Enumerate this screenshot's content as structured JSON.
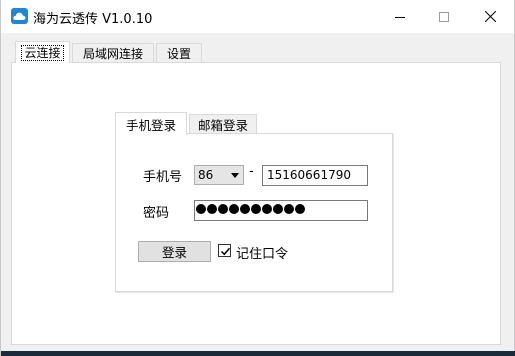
{
  "window": {
    "title": "海为云透传 V1.0.10",
    "icon": "cloud-app-icon",
    "controls": [
      "minimize-icon",
      "maximize-icon",
      "close-icon"
    ]
  },
  "outer_tabs": [
    {
      "label": "云连接",
      "active": true
    },
    {
      "label": "局域网连接",
      "active": false
    },
    {
      "label": "设置",
      "active": false
    }
  ],
  "inner_tabs": [
    {
      "label": "手机登录",
      "active": true
    },
    {
      "label": "邮箱登录",
      "active": false
    }
  ],
  "form": {
    "phone_label": "手机号",
    "country_code": "86",
    "separator": "-",
    "phone_value": "15160661790",
    "password_label": "密码",
    "password_mask_count": 10,
    "login_button": "登录",
    "remember_checked": true,
    "remember_label": "记住口令"
  },
  "colors": {
    "app_icon": "#1e88d6",
    "window_bg": "#f0f0f0",
    "panel_bg": "#ffffff"
  }
}
